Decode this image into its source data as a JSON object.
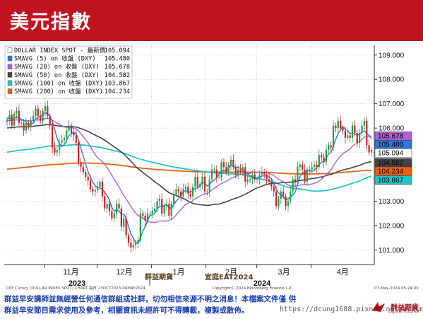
{
  "slide_title": "美元指數",
  "colors": {
    "title_bg": "#c1121f",
    "candle_up": "#1e9e4a",
    "candle_down": "#d42020",
    "smavg5": "#2f78d8",
    "smavg20": "#b060d8",
    "smavg50": "#444444",
    "smavg100": "#22c4cc",
    "smavg200": "#f06010"
  },
  "chart_data": {
    "type": "candlestick",
    "title": "",
    "ylim": [
      100.4,
      109.4
    ],
    "yticks": [
      101.0,
      102.0,
      103.0,
      104.0,
      105.0,
      106.0,
      107.0,
      108.0,
      109.0
    ],
    "ytick_labels": [
      "101.000",
      "102.000",
      "103.000",
      "104.000",
      "105.000",
      "106.000",
      "107.000",
      "108.000",
      "109.000"
    ],
    "months": [
      "11月",
      "12月",
      "1月",
      "2月",
      "3月",
      "4月"
    ],
    "year_labels": [
      "2023",
      "2024"
    ],
    "x_start": "2023-10-09",
    "x_end": "2024-05-07",
    "legend": [
      {
        "name": "DOLLAR INDEX SPOT - 最新價",
        "value": "105.094",
        "color": "#ffffff"
      },
      {
        "name": "SMAVG (5)  on 收盤 (DXY)",
        "value": "105.480",
        "color": "#2f78d8"
      },
      {
        "name": "SMAVG (20) on 收盤 (DXY)",
        "value": "105.678",
        "color": "#b060d8"
      },
      {
        "name": "SMAVG (50) on 收盤 (DXY)",
        "value": "104.582",
        "color": "#444444"
      },
      {
        "name": "SMAVG (100) on 收盤 (DXY)",
        "value": "103.867",
        "color": "#22c4cc"
      },
      {
        "name": "SMAVG (200) on 收盤 (DXY)",
        "value": "104.234",
        "color": "#f06010"
      }
    ],
    "last_value_tags": [
      {
        "label": "105.678",
        "value": 105.678,
        "color": "#b060d8"
      },
      {
        "label": "105.480",
        "value": 105.48,
        "color": "#2f78d8"
      },
      {
        "label": "105.094",
        "value": 105.094,
        "color": "#ffffff"
      },
      {
        "label": "104.582",
        "value": 104.582,
        "color": "#444444"
      },
      {
        "label": "104.234",
        "value": 104.234,
        "color": "#f06010"
      },
      {
        "label": "103.867",
        "value": 103.867,
        "color": "#22c4cc"
      }
    ],
    "close": [
      106.35,
      106.55,
      106.1,
      106.6,
      106.7,
      106.2,
      106.2,
      105.9,
      106.2,
      106.1,
      106.3,
      106.5,
      106.8,
      106.5,
      106.3,
      106.7,
      106.9,
      106.5,
      106.1,
      105.2,
      105.0,
      105.1,
      105.4,
      105.5,
      105.6,
      105.9,
      106.1,
      105.8,
      105.7,
      105.4,
      104.6,
      104.4,
      104.2,
      104.0,
      103.85,
      103.5,
      103.4,
      103.45,
      103.6,
      103.8,
      103.2,
      102.7,
      102.9,
      102.6,
      102.3,
      102.5,
      102.9,
      102.7,
      101.95,
      102.3,
      101.6,
      101.3,
      101.1,
      101.2,
      101.3,
      101.4,
      102.5,
      102.4,
      102.2,
      102.5,
      102.5,
      102.6,
      102.7,
      103.0,
      103.1,
      102.5,
      102.8,
      102.9,
      102.4,
      102.9,
      103.3,
      103.5,
      103.4,
      103.2,
      103.5,
      103.6,
      103.3,
      103.2,
      103.6,
      104.0,
      103.6,
      103.7,
      104.0,
      103.4,
      103.4,
      103.9,
      104.3,
      104.3,
      104.0,
      104.0,
      104.6,
      104.4,
      104.2,
      104.5,
      104.7,
      104.4,
      104.1,
      104.3,
      104.2,
      104.4,
      103.8,
      103.9,
      103.9,
      104.1,
      103.9,
      103.9,
      104.1,
      104.2,
      104.1,
      103.9,
      103.8,
      103.6,
      103.4,
      102.8,
      103.1,
      103.4,
      103.2,
      102.8,
      103.0,
      103.4,
      103.9,
      103.8,
      104.4,
      104.5,
      104.3,
      103.8,
      104.3,
      104.3,
      104.4,
      104.5,
      104.4,
      104.9,
      104.8,
      104.6,
      105.1,
      105.3,
      105.2,
      106.1,
      106.0,
      106.3,
      106.0,
      105.9,
      105.6,
      105.7,
      105.6,
      106.1,
      105.8,
      105.4,
      105.8,
      106.1,
      106.3,
      105.3,
      105.0,
      105.1
    ]
  },
  "footer": {
    "source_left": "DXY Curncy (DOLLAR INDEX SPOT) CHART 每日 23OCT2023-06MAY2024",
    "copyright": "Copyright© 2024 Bloomberg Finance L.P.",
    "date_time": "07-May-2024 05:24:09"
  },
  "overlay": {
    "group_name": "群益期貨",
    "family_name": "宜庭EAT2024"
  },
  "disclaimer": {
    "line1": "群益早安講師並無經營任何通信群組或社群，切勿相信來源不明之消息！本檔案文件僅 供",
    "line2": "群益早安節目需求使用及參考，相關資訊未經許可不得轉載，複製或散佈。"
  },
  "brand": {
    "name": "群益期貨",
    "sub": "capital futures"
  },
  "url_watermark": "https://dcung1688.pixnet.net/album"
}
